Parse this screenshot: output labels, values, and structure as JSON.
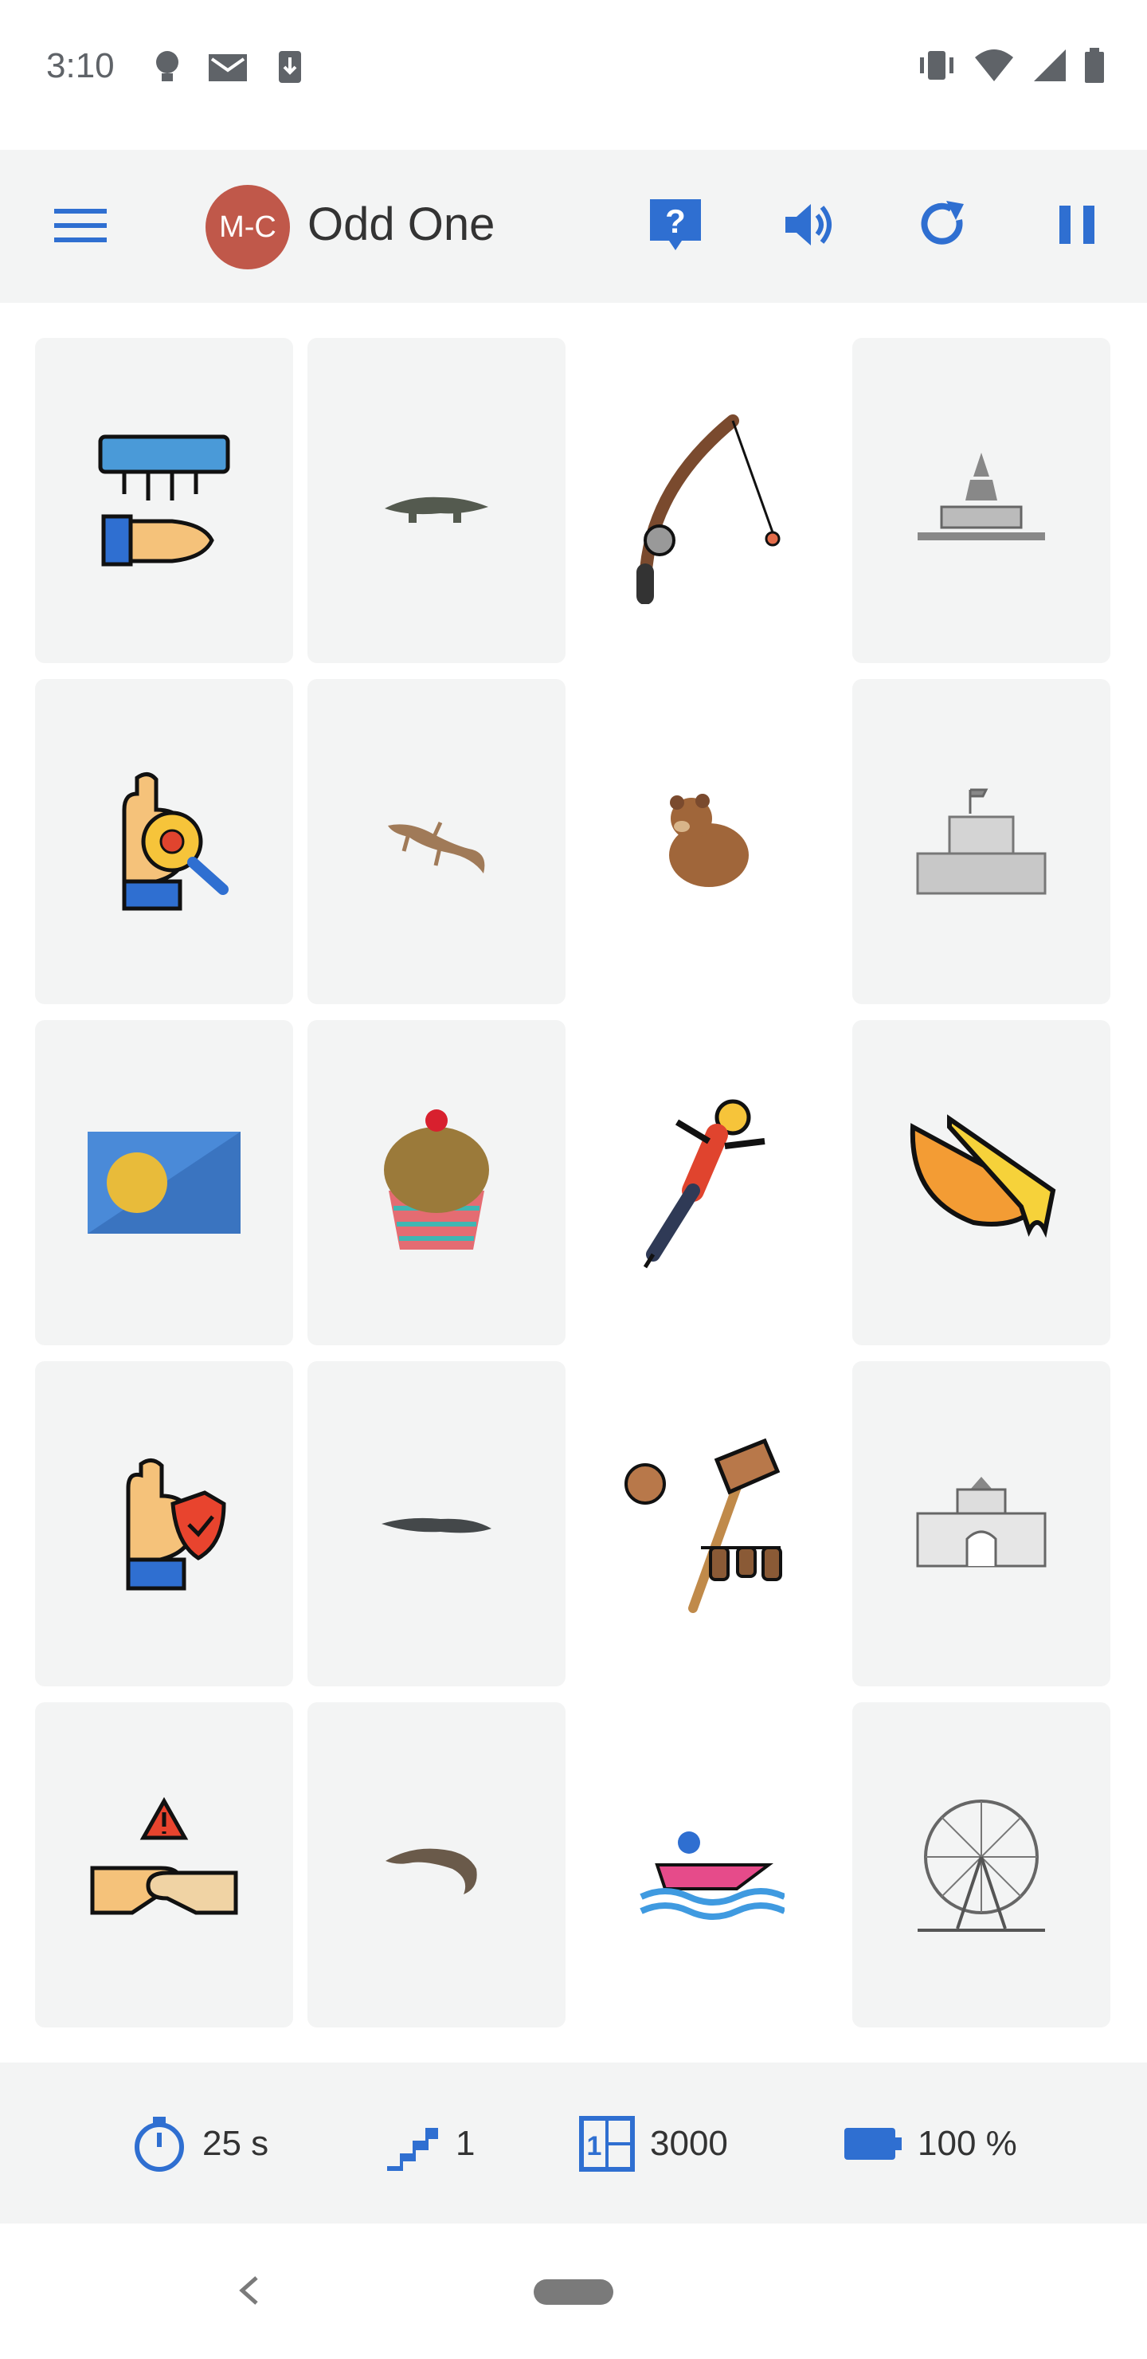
{
  "status": {
    "time": "3:10"
  },
  "app": {
    "title": "Odd One",
    "logo_text": "M-C",
    "accent": "#2f6fd1"
  },
  "cards": [
    {
      "icon": "hand-dryer-icon"
    },
    {
      "icon": "crocodile-icon"
    },
    {
      "icon": "fishing-rod-icon"
    },
    {
      "icon": "temple-icon"
    },
    {
      "icon": "hand-virus-inspection-icon"
    },
    {
      "icon": "gecko-icon"
    },
    {
      "icon": "bear-icon"
    },
    {
      "icon": "mausoleum-icon"
    },
    {
      "icon": "palau-flag-icon"
    },
    {
      "icon": "cupcake-icon"
    },
    {
      "icon": "bungee-jumper-icon"
    },
    {
      "icon": "cheese-icon"
    },
    {
      "icon": "hand-shield-icon"
    },
    {
      "icon": "alligator-icon"
    },
    {
      "icon": "croquet-mallet-icon"
    },
    {
      "icon": "arch-building-icon"
    },
    {
      "icon": "handshake-warning-icon"
    },
    {
      "icon": "lizard-icon"
    },
    {
      "icon": "speedboat-icon"
    },
    {
      "icon": "ferris-wheel-icon"
    }
  ],
  "stats": {
    "time_left": "25 s",
    "level": "1",
    "score": "3000",
    "battery": "100 %"
  }
}
